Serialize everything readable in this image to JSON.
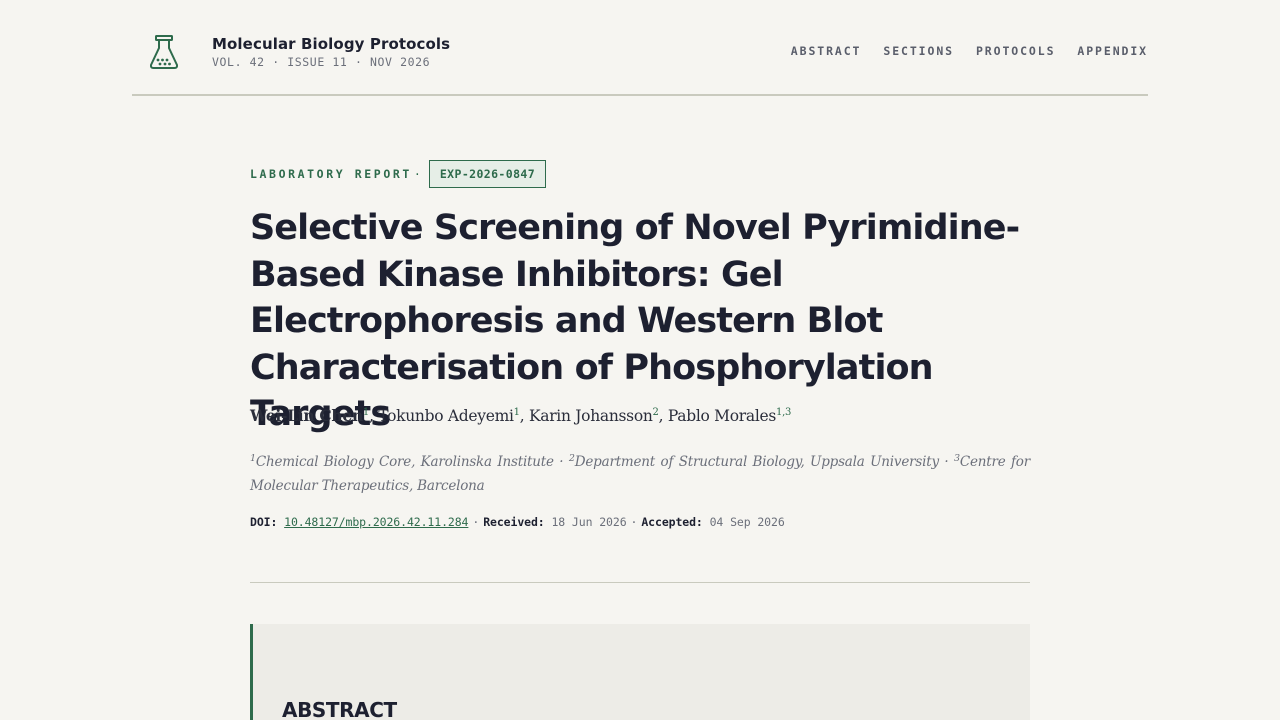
{
  "header": {
    "journal_name": "Molecular Biology Protocols",
    "issue": "VOL. 42 · ISSUE 11 · NOV 2026",
    "logo_icon": "flask-icon",
    "nav": [
      {
        "label": "ABSTRACT"
      },
      {
        "label": "SECTIONS"
      },
      {
        "label": "PROTOCOLS"
      },
      {
        "label": "APPENDIX"
      }
    ]
  },
  "article": {
    "report_type": "LABORATORY REPORT",
    "separator": "·",
    "report_id": "EXP-2026-0847",
    "title": "Selective Screening of Novel Pyrimidine-Based Kinase Inhibitors: Gel Electrophoresis and Western Blot Characterisation of Phosphorylation Targets",
    "authors": [
      {
        "name": "Wei-Lin Chen",
        "sup": "1"
      },
      {
        "name": "Tokunbo Adeyemi",
        "sup": "1"
      },
      {
        "name": "Karin Johansson",
        "sup": "2"
      },
      {
        "name": "Pablo Morales",
        "sup": "1,3"
      }
    ],
    "affiliations": [
      {
        "sup": "1",
        "text": "Chemical Biology Core, Karolinska Institute"
      },
      {
        "sup": "2",
        "text": "Department of Structural Biology, Uppsala University"
      },
      {
        "sup": "3",
        "text": "Centre for Molecular Therapeutics, Barcelona"
      }
    ],
    "meta": {
      "doi_label": "DOI:",
      "doi": "10.48127/mbp.2026.42.11.284",
      "received_label": "Received:",
      "received": "18 Jun 2026",
      "accepted_label": "Accepted:",
      "accepted": "04 Sep 2026"
    },
    "abstract_heading": "ABSTRACT"
  },
  "colors": {
    "background": "#f6f5f1",
    "accent": "#2e6b4c",
    "text": "#1d2030",
    "muted": "#6b6f7a"
  }
}
